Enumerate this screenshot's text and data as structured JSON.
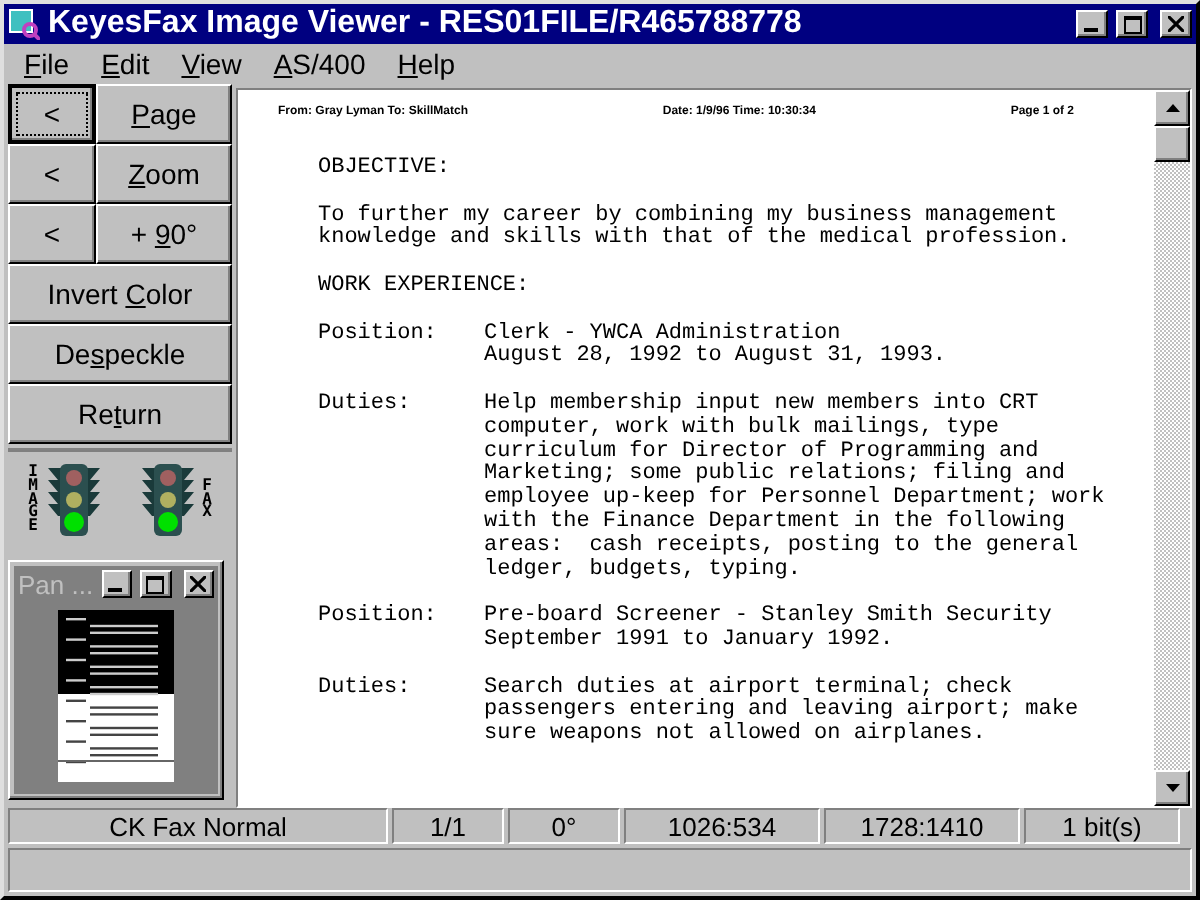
{
  "window": {
    "title": "KeyesFax Image Viewer - RES01FILE/R465788778"
  },
  "menu": [
    {
      "key": "F",
      "post": "ile"
    },
    {
      "key": "E",
      "post": "dit"
    },
    {
      "key": "V",
      "post": "iew"
    },
    {
      "key": "A",
      "post": "S/400"
    },
    {
      "key": "H",
      "post": "elp"
    }
  ],
  "toolbar": {
    "nav_rows": [
      {
        "back": "<",
        "key": "P",
        "post": "age",
        "focused": true
      },
      {
        "back": "<",
        "key": "Z",
        "post": "oom",
        "focused": false
      },
      {
        "back": "<",
        "pre": "+ ",
        "key": "9",
        "post": "0°",
        "focused": false
      }
    ],
    "buttons": [
      {
        "pre": "Invert ",
        "key": "C",
        "post": "olor"
      },
      {
        "pre": "De",
        "key": "s",
        "post": "peckle"
      },
      {
        "pre": "Re",
        "key": "t",
        "post": "urn"
      }
    ],
    "lights": [
      {
        "label": "IMAGE",
        "kind": "label_before"
      },
      {
        "label": "FAX",
        "kind": "label_after"
      }
    ]
  },
  "pan_window": {
    "title": "Pan ..."
  },
  "document": {
    "header": {
      "from": "From: Gray Lyman  To: SkillMatch",
      "date": "Date: 1/9/96  Time: 10:30:34",
      "page": "Page 1 of 2"
    },
    "blocks": [
      {
        "kind": "heading",
        "text": "OBJECTIVE:"
      },
      {
        "kind": "para",
        "lines": [
          "To further my career by combining my business management",
          "knowledge and skills with that of the medical profession."
        ]
      },
      {
        "kind": "heading",
        "text": "WORK EXPERIENCE:"
      },
      {
        "kind": "entry",
        "label": "Position:",
        "lines": [
          "Clerk - YWCA Administration",
          "August 28, 1992 to August 31, 1993."
        ]
      },
      {
        "kind": "entry",
        "label": "Duties:",
        "lines": [
          "Help membership input new members into CRT",
          "computer, work with bulk mailings, type",
          "curriculum for Director of Programming and",
          "Marketing; some public relations; filing and",
          "employee up-keep for Personnel Department; work",
          "with the Finance Department in the following",
          "areas:  cash receipts, posting to the general",
          "ledger, budgets, typing."
        ]
      },
      {
        "kind": "entry",
        "label": "Position:",
        "lines": [
          "Pre-board Screener - Stanley Smith Security",
          "September 1991 to January 1992."
        ]
      },
      {
        "kind": "entry",
        "label": "Duties:",
        "lines": [
          "Search duties at airport terminal; check",
          "passengers entering and leaving airport; make",
          "sure weapons not allowed on airplanes."
        ]
      }
    ]
  },
  "status_bar": [
    "CK Fax Normal",
    "1/1",
    "0°",
    "1026:534",
    "1728:1410",
    "1 bit(s)"
  ]
}
